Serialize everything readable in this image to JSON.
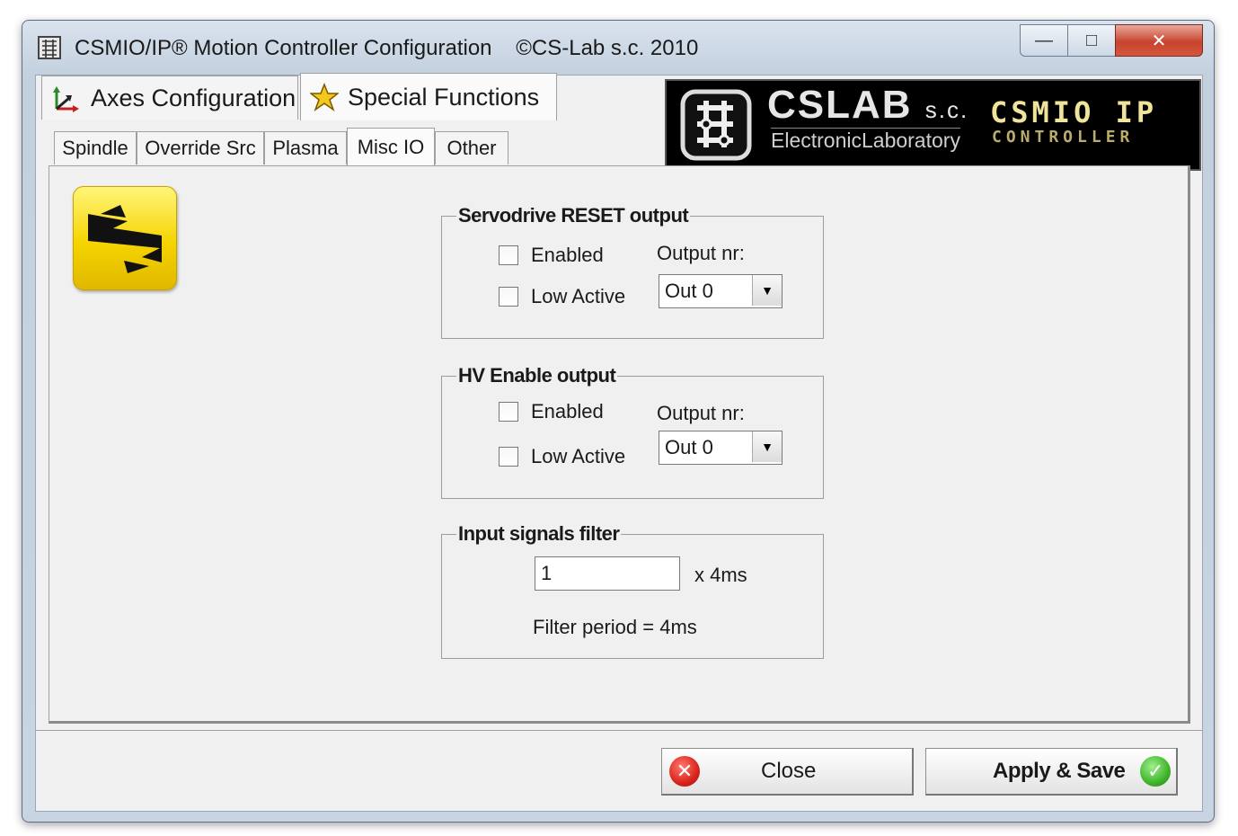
{
  "window": {
    "title": "CSMIO/IP® Motion Controller Configuration    ©CS-Lab s.c. 2010",
    "controls": {
      "minimize": "—",
      "maximize": "□",
      "close": "✕"
    }
  },
  "main_tabs": [
    {
      "label": "Axes Configuration",
      "icon": "axes-icon"
    },
    {
      "label": "Special Functions",
      "icon": "star-icon"
    }
  ],
  "sub_tabs": [
    {
      "label": "Spindle"
    },
    {
      "label": "Override Src"
    },
    {
      "label": "Plasma"
    },
    {
      "label": "Misc IO",
      "active": true
    },
    {
      "label": "Other"
    }
  ],
  "banner": {
    "company": "CSLAB",
    "company_suffix": "s.c.",
    "tagline": "ElectronicLaboratory",
    "product": "CSMIO IP",
    "product_sub": "CONTROLLER"
  },
  "servodrive_reset": {
    "legend": "Servodrive RESET output",
    "enabled_label": "Enabled",
    "enabled_checked": false,
    "low_active_label": "Low Active",
    "low_active_checked": false,
    "output_label": "Output nr:",
    "output_value": "Out 0"
  },
  "hv_enable": {
    "legend": "HV Enable output",
    "enabled_label": "Enabled",
    "enabled_checked": false,
    "low_active_label": "Low Active",
    "low_active_checked": false,
    "output_label": "Output nr:",
    "output_value": "Out 0"
  },
  "input_filter": {
    "legend": "Input signals filter",
    "value": "1",
    "unit": "x 4ms",
    "period_text": "Filter period = 4ms"
  },
  "buttons": {
    "close_label": "Close",
    "apply_label": "Apply & Save"
  },
  "colors": {
    "close_icon": "#d9241c",
    "apply_icon": "#3fb52a",
    "logo_yellow": "#f5d400"
  }
}
